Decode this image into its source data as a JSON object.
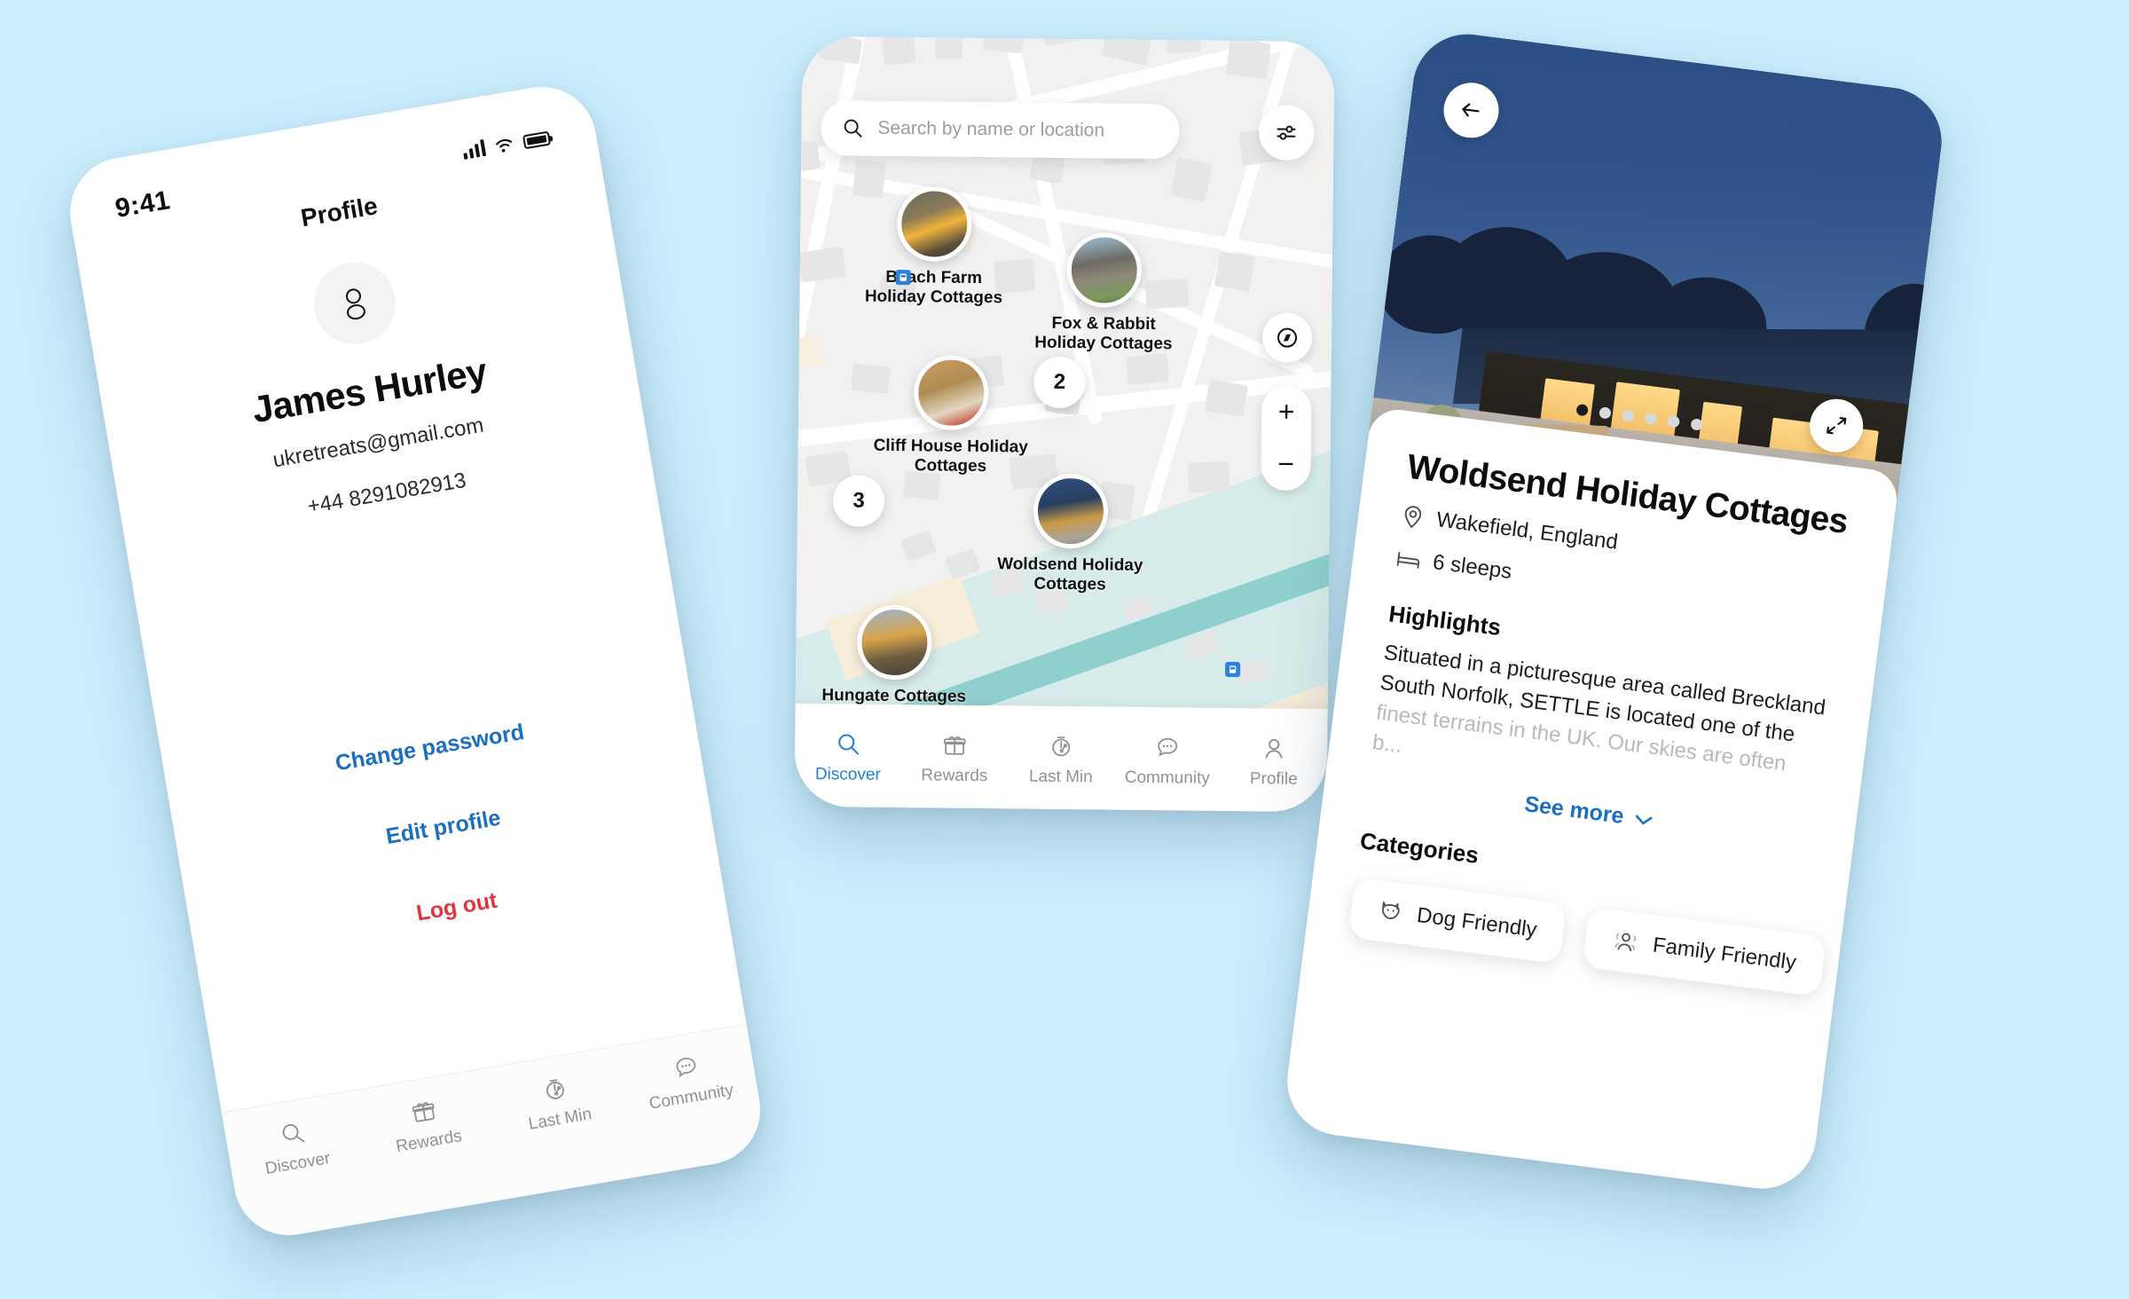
{
  "canvas": {
    "background": "#cbeefd"
  },
  "profile_screen": {
    "status": {
      "time": "9:41",
      "signal_icon": "signal-bars-icon",
      "wifi_icon": "wifi-icon",
      "battery_icon": "battery-icon"
    },
    "title": "Profile",
    "avatar_icon": "user-avatar-icon",
    "name": "James Hurley",
    "email": "ukretreats@gmail.com",
    "phone": "+44 8291082913",
    "links": [
      {
        "label": "Change password",
        "color": "#1b6fc0"
      },
      {
        "label": "Edit profile",
        "color": "#1b6fc0"
      },
      {
        "label": "Log out",
        "color": "#e0343f"
      }
    ],
    "nav": [
      {
        "label": "Discover",
        "icon": "search-icon",
        "active": false
      },
      {
        "label": "Rewards",
        "icon": "gift-icon",
        "active": false
      },
      {
        "label": "Last Min",
        "icon": "stopwatch-percent-icon",
        "active": false
      },
      {
        "label": "Community",
        "icon": "chat-bubble-icon",
        "active": false
      }
    ]
  },
  "map_screen": {
    "search": {
      "placeholder": "Search by name or location",
      "value": "",
      "icon": "search-icon"
    },
    "filter_button": {
      "icon": "sliders-filter-icon"
    },
    "controls": {
      "compass": {
        "icon": "compass-icon"
      },
      "zoom_in": {
        "label": "+"
      },
      "zoom_out": {
        "label": "−"
      }
    },
    "pins": [
      {
        "label": "Beach Farm\nHoliday Cottages",
        "thumb": "cabin-evening-thumb"
      },
      {
        "label": "Fox & Rabbit\nHoliday Cottages",
        "thumb": "stone-cottage-thumb"
      },
      {
        "label": "Cliff House Holiday\nCottages",
        "thumb": "barn-interior-thumb"
      },
      {
        "label": "Woldsend Holiday\nCottages",
        "thumb": "woldsend-dusk-thumb"
      },
      {
        "label": "Hungate Cottages",
        "thumb": "hungate-thumb"
      }
    ],
    "clusters": [
      {
        "count": "2"
      },
      {
        "count": "3"
      }
    ],
    "poi_icons": [
      "bus-stop-icon",
      "bus-stop-icon"
    ],
    "nav": [
      {
        "label": "Discover",
        "icon": "search-icon",
        "active": true
      },
      {
        "label": "Rewards",
        "icon": "gift-icon",
        "active": false
      },
      {
        "label": "Last Min",
        "icon": "stopwatch-percent-icon",
        "active": false
      },
      {
        "label": "Community",
        "icon": "chat-bubble-icon",
        "active": false
      },
      {
        "label": "Profile",
        "icon": "person-icon",
        "active": false
      }
    ]
  },
  "detail_screen": {
    "back_button": {
      "icon": "arrow-left-icon"
    },
    "expand_button": {
      "icon": "expand-diagonal-icon"
    },
    "gallery": {
      "dots_total": 6,
      "active_index": 0
    },
    "title": "Woldsend Holiday Cottages",
    "location": {
      "icon": "location-pin-icon",
      "text": "Wakefield, England"
    },
    "sleeps": {
      "icon": "bed-icon",
      "text": "6 sleeps"
    },
    "highlights_heading": "Highlights",
    "highlights_text": "Situated in a picturesque area called Breckland South Norfolk, SETTLE is located one of the ",
    "highlights_text_faded": "finest terrains in the UK. Our skies are often b...",
    "see_more": {
      "label": "See more",
      "icon": "chevron-down-icon",
      "color": "#1b6fc0"
    },
    "categories_heading": "Categories",
    "categories": [
      {
        "label": "Dog Friendly",
        "icon": "dog-icon"
      },
      {
        "label": "Family Friendly",
        "icon": "family-icon"
      }
    ]
  }
}
